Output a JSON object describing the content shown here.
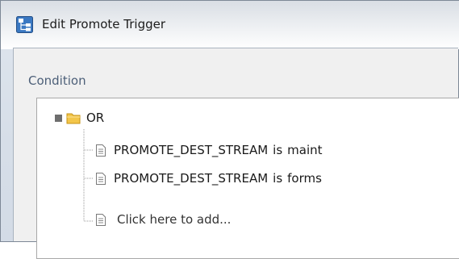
{
  "window": {
    "title": "Edit Promote Trigger",
    "icon": "app-tree-icon"
  },
  "condition": {
    "section_label": "Condition",
    "root": {
      "operator": "OR",
      "icon": "folder-icon",
      "toggle_icon": "collapse-icon"
    },
    "rules": [
      {
        "field": "PROMOTE_DEST_STREAM",
        "operator": "is",
        "value": "maint",
        "icon": "document-icon"
      },
      {
        "field": "PROMOTE_DEST_STREAM",
        "operator": "is",
        "value": "forms",
        "icon": "document-icon"
      }
    ],
    "add_placeholder": "Click here to add..."
  },
  "colors": {
    "label_blue": "#4c5f78",
    "folder_yellow": "#f3c64a",
    "window_border": "#7d8896"
  }
}
